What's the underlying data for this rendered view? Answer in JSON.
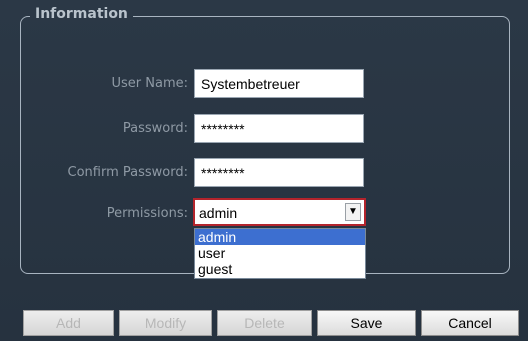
{
  "fieldset": {
    "legend": "Information"
  },
  "form": {
    "user_name_label": "User Name:",
    "user_name_value": "Systembetreuer",
    "password_label": "Password:",
    "password_value": "********",
    "confirm_password_label": "Confirm Password:",
    "confirm_password_value": "********",
    "permissions_label": "Permissions:",
    "permissions_value": "admin",
    "permissions_options": [
      "admin",
      "user",
      "guest"
    ],
    "permissions_selected_index": 0
  },
  "buttons": {
    "add": "Add",
    "modify": "Modify",
    "delete": "Delete",
    "save": "Save",
    "cancel": "Cancel"
  },
  "icons": {
    "dropdown_arrow": "▼"
  },
  "colors": {
    "background": "#2b3846",
    "selection": "#3d6fd0",
    "focus_border": "#b3242c"
  }
}
